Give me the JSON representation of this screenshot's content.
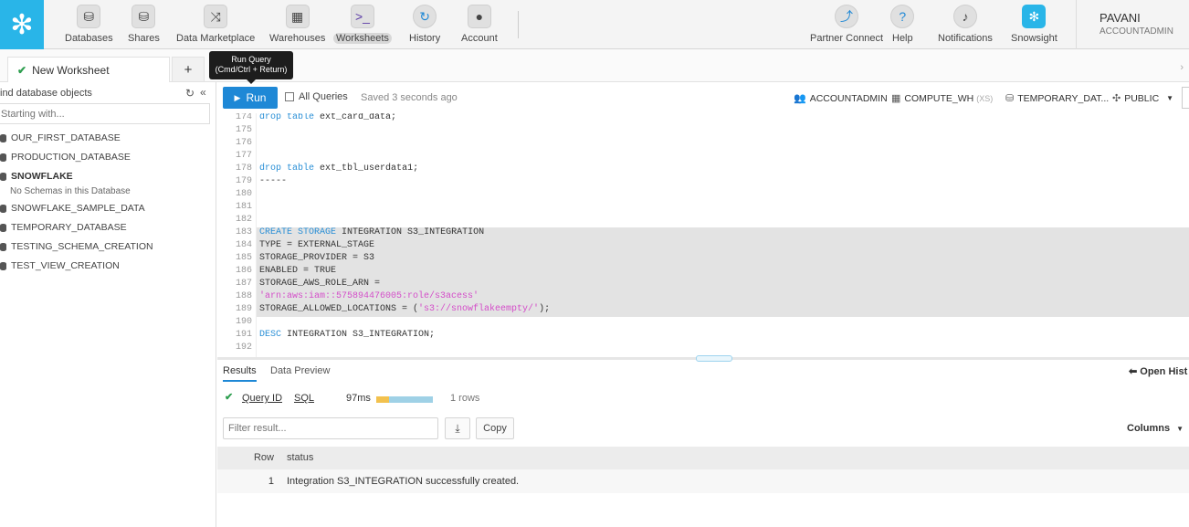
{
  "nav": {
    "items": [
      {
        "label": "Databases",
        "icon": "database-icon"
      },
      {
        "label": "Shares",
        "icon": "shares-icon"
      },
      {
        "label": "Data Marketplace",
        "icon": "marketplace-icon"
      },
      {
        "label": "Warehouses",
        "icon": "warehouse-icon"
      },
      {
        "label": "Worksheets",
        "icon": "worksheet-icon",
        "active": true
      },
      {
        "label": "History",
        "icon": "history-icon"
      },
      {
        "label": "Account",
        "icon": "account-icon"
      }
    ],
    "right_items": [
      {
        "label": "Partner Connect",
        "icon": "partner-connect-icon"
      },
      {
        "label": "Help",
        "icon": "help-icon"
      },
      {
        "label": "Notifications",
        "icon": "bell-icon"
      },
      {
        "label": "Snowsight",
        "icon": "snowsight-icon"
      }
    ],
    "user": {
      "name": "PAVANI",
      "role": "ACCOUNTADMIN"
    }
  },
  "tabs": {
    "worksheet": "New Worksheet",
    "add": "+"
  },
  "tooltip": {
    "line1": "Run Query",
    "line2": "(Cmd/Ctrl + Return)"
  },
  "sidebar": {
    "title": "ind database objects",
    "search_placeholder": "Starting with...",
    "databases": [
      {
        "name": "OUR_FIRST_DATABASE"
      },
      {
        "name": "PRODUCTION_DATABASE"
      },
      {
        "name": "SNOWFLAKE",
        "expanded": true
      },
      {
        "name": "SNOWFLAKE_SAMPLE_DATA"
      },
      {
        "name": "TEMPORARY_DATABASE"
      },
      {
        "name": "TESTING_SCHEMA_CREATION"
      },
      {
        "name": "TEST_VIEW_CREATION"
      }
    ],
    "no_schemas": "No Schemas in this Database"
  },
  "toolbar": {
    "run": "Run",
    "all_queries": "All Queries",
    "saved": "Saved 3 seconds ago",
    "role": "ACCOUNTADMIN",
    "warehouse": "COMPUTE_WH",
    "warehouse_size": "(XS)",
    "database": "TEMPORARY_DAT...",
    "schema": "PUBLIC"
  },
  "editor": {
    "lines": [
      {
        "n": "174",
        "text": "drop table ext_card_data;"
      },
      {
        "n": "175",
        "text": ""
      },
      {
        "n": "176",
        "text": ""
      },
      {
        "n": "177",
        "text": ""
      },
      {
        "n": "178",
        "text": "drop table ext_tbl_userdata1;"
      },
      {
        "n": "179",
        "text": "-----"
      },
      {
        "n": "180",
        "text": ""
      },
      {
        "n": "181",
        "text": ""
      },
      {
        "n": "182",
        "text": ""
      },
      {
        "n": "183",
        "text": "CREATE STORAGE INTEGRATION S3_INTEGRATION"
      },
      {
        "n": "184",
        "text": "TYPE = EXTERNAL_STAGE"
      },
      {
        "n": "185",
        "text": "STORAGE_PROVIDER = S3"
      },
      {
        "n": "186",
        "text": "ENABLED = TRUE"
      },
      {
        "n": "187",
        "text": "STORAGE_AWS_ROLE_ARN ="
      },
      {
        "n": "188",
        "text": "'arn:aws:iam::575894476005:role/s3acess'"
      },
      {
        "n": "189",
        "text": "STORAGE_ALLOWED_LOCATIONS = ('s3://snowflakeempty/');"
      },
      {
        "n": "190",
        "text": ""
      },
      {
        "n": "191",
        "text": "DESC INTEGRATION S3_INTEGRATION;"
      },
      {
        "n": "192",
        "text": ""
      }
    ],
    "highlighted_lines": [
      "183",
      "184",
      "185",
      "186",
      "187",
      "188",
      "189"
    ]
  },
  "results": {
    "tab_results": "Results",
    "tab_preview": "Data Preview",
    "open_history": "Open Hist",
    "query_id": "Query ID",
    "sql": "SQL",
    "duration": "97ms",
    "rows": "1 rows",
    "filter_placeholder": "Filter result...",
    "copy": "Copy",
    "columns": "Columns",
    "headers": [
      "Row",
      "status"
    ],
    "data": [
      {
        "row": "1",
        "status": "Integration S3_INTEGRATION successfully created."
      }
    ]
  }
}
